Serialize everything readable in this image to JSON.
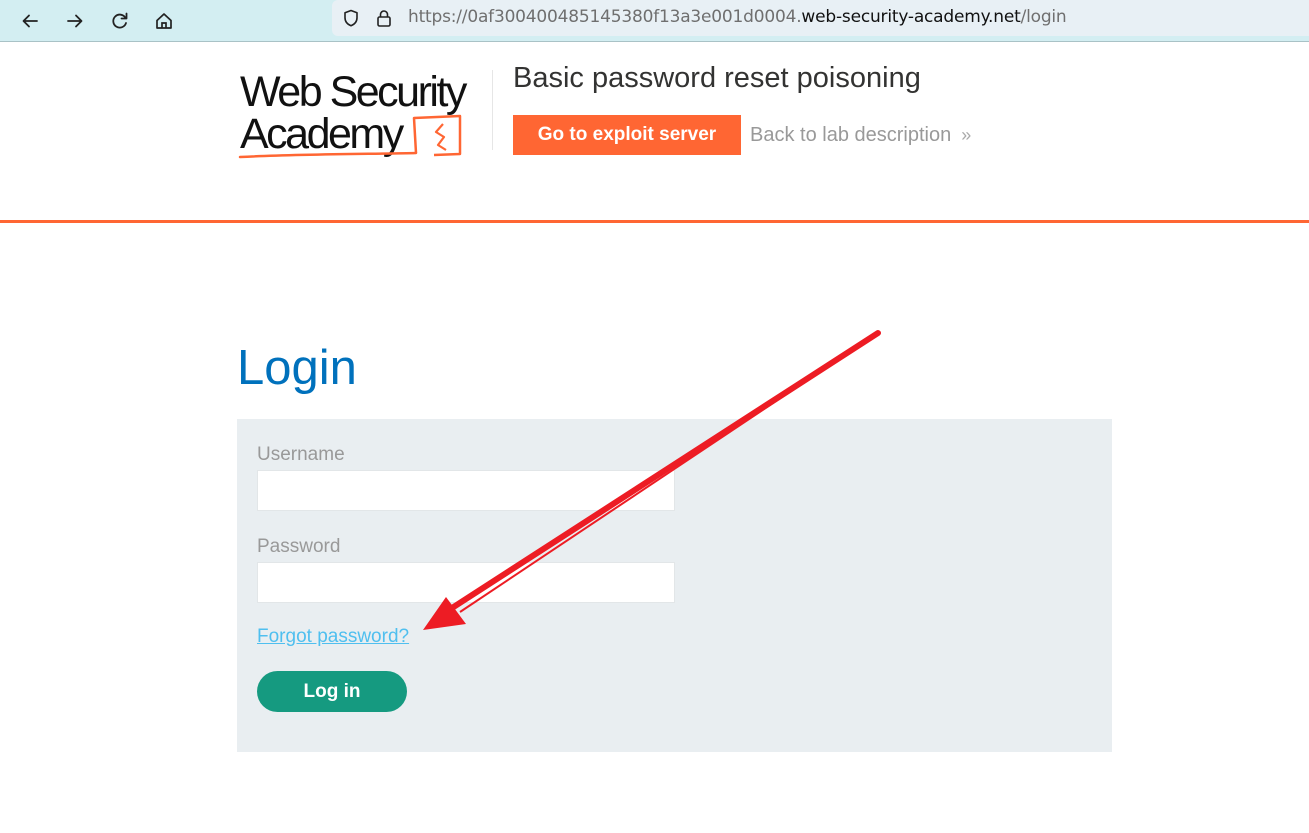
{
  "browser": {
    "url_prefix": "https://0af300400485145380f13a3e001d0004.",
    "url_host": "web-security-academy.net",
    "url_path": "/login",
    "nav_icons": [
      "back-icon",
      "forward-icon",
      "reload-icon",
      "home-icon"
    ],
    "url_icons": [
      "shield-icon",
      "lock-icon"
    ]
  },
  "header": {
    "logo_line1": "Web Security",
    "logo_line2": "Academy",
    "lab_title": "Basic password reset poisoning",
    "exploit_button": "Go to exploit server",
    "back_link": "Back to lab description",
    "back_link_icon": "»"
  },
  "login": {
    "title": "Login",
    "username_label": "Username",
    "username_value": "",
    "password_label": "Password",
    "password_value": "",
    "forgot_link": "Forgot password?",
    "submit_button": "Log in"
  },
  "colors": {
    "brand_orange": "#ff6633",
    "login_title_blue": "#0071bc",
    "link_blue": "#4fbfef",
    "button_green": "#159a80",
    "panel_bg": "#e9eef1",
    "annotation_red": "#ed1c24"
  }
}
